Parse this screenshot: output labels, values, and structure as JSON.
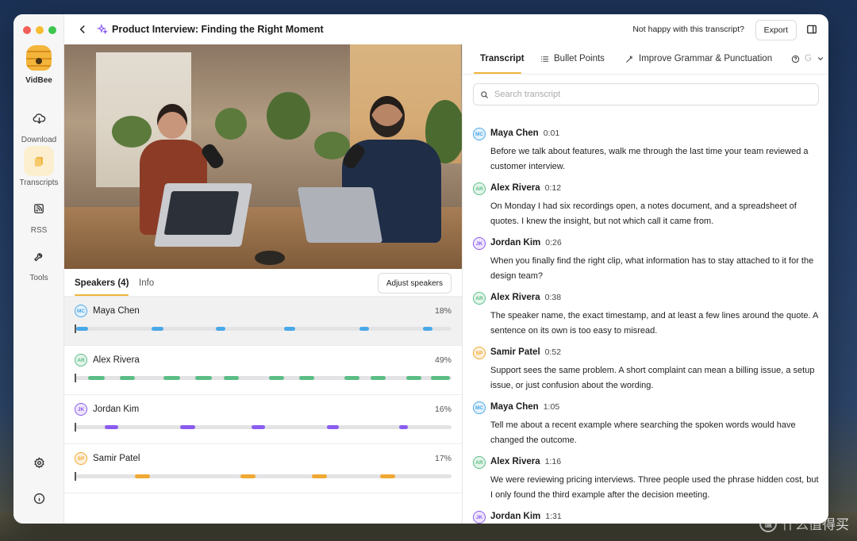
{
  "window": {
    "title": "Product Interview: Finding the Right Moment",
    "not_happy": "Not happy with this transcript?",
    "export_label": "Export"
  },
  "sidebar": {
    "app_name": "VidBee",
    "items": [
      {
        "label": "Download",
        "icon": "download-icon"
      },
      {
        "label": "Transcripts",
        "icon": "transcripts-icon",
        "active": true
      },
      {
        "label": "RSS",
        "icon": "rss-icon"
      },
      {
        "label": "Tools",
        "icon": "tools-icon"
      }
    ]
  },
  "speakers_panel": {
    "tab_speakers": "Speakers (4)",
    "tab_info": "Info",
    "adjust_label": "Adjust speakers",
    "speakers": [
      {
        "initials": "MC",
        "name": "Maya Chen",
        "percent": "18%",
        "color": "#4aa8e8",
        "bg": "#e3f1fb",
        "segments": [
          [
            0.5,
            3.5
          ],
          [
            20.5,
            23.5
          ],
          [
            37.5,
            40
          ],
          [
            55.5,
            58.5
          ],
          [
            75.5,
            78
          ],
          [
            92.5,
            95
          ]
        ]
      },
      {
        "initials": "AR",
        "name": "Alex Rivera",
        "percent": "49%",
        "color": "#5bbd85",
        "bg": "#e4f5ea",
        "segments": [
          [
            3.5,
            8
          ],
          [
            12,
            16
          ],
          [
            23.5,
            28
          ],
          [
            32,
            36.5
          ],
          [
            39.5,
            43.5
          ],
          [
            51.5,
            55.5
          ],
          [
            59.5,
            63.5
          ],
          [
            71.5,
            75.5
          ],
          [
            78.5,
            82.5
          ],
          [
            88,
            92
          ],
          [
            94.5,
            99.5
          ]
        ]
      },
      {
        "initials": "JK",
        "name": "Jordan Kim",
        "percent": "16%",
        "color": "#8a5cf0",
        "bg": "#eee6fd",
        "segments": [
          [
            8,
            11.5
          ],
          [
            28,
            32
          ],
          [
            47,
            50.5
          ],
          [
            67,
            70
          ],
          [
            86,
            88.5
          ]
        ]
      },
      {
        "initials": "SP",
        "name": "Samir Patel",
        "percent": "17%",
        "color": "#f0a933",
        "bg": "#fdf0db",
        "segments": [
          [
            16,
            20
          ],
          [
            44,
            48
          ],
          [
            63,
            67
          ],
          [
            81,
            85
          ]
        ]
      }
    ]
  },
  "transcript_panel": {
    "tabs": [
      {
        "label": "Transcript",
        "active": true
      },
      {
        "label": "Bullet Points",
        "icon": "list-icon"
      },
      {
        "label": "Improve Grammar & Punctuation",
        "icon": "sparkle-icon"
      },
      {
        "label": "G",
        "icon": "help-icon"
      }
    ],
    "search_placeholder": "Search transcript",
    "entries": [
      {
        "initials": "MC",
        "name": "Maya Chen",
        "time": "0:01",
        "color": "#4aa8e8",
        "bg": "#e3f1fb",
        "text": "Before we talk about features, walk me through the last time your team reviewed a customer interview."
      },
      {
        "initials": "AR",
        "name": "Alex Rivera",
        "time": "0:12",
        "color": "#5bbd85",
        "bg": "#e4f5ea",
        "text": "On Monday I had six recordings open, a notes document, and a spreadsheet of quotes. I knew the insight, but not which call it came from."
      },
      {
        "initials": "JK",
        "name": "Jordan Kim",
        "time": "0:26",
        "color": "#8a5cf0",
        "bg": "#eee6fd",
        "text": "When you finally find the right clip, what information has to stay attached to it for the design team?"
      },
      {
        "initials": "AR",
        "name": "Alex Rivera",
        "time": "0:38",
        "color": "#5bbd85",
        "bg": "#e4f5ea",
        "text": "The speaker name, the exact timestamp, and at least a few lines around the quote. A sentence on its own is too easy to misread."
      },
      {
        "initials": "SP",
        "name": "Samir Patel",
        "time": "0:52",
        "color": "#f0a933",
        "bg": "#fdf0db",
        "text": "Support sees the same problem. A short complaint can mean a billing issue, a setup issue, or just confusion about the wording."
      },
      {
        "initials": "MC",
        "name": "Maya Chen",
        "time": "1:05",
        "color": "#4aa8e8",
        "bg": "#e3f1fb",
        "text": "Tell me about a recent example where searching the spoken words would have changed the outcome."
      },
      {
        "initials": "AR",
        "name": "Alex Rivera",
        "time": "1:16",
        "color": "#5bbd85",
        "bg": "#e4f5ea",
        "text": "We were reviewing pricing interviews. Three people used the phrase hidden cost, but I only found the third example after the decision meeting."
      },
      {
        "initials": "JK",
        "name": "Jordan Kim",
        "time": "1:31",
        "color": "#8a5cf0",
        "bg": "#eee6fd",
        "text": ""
      }
    ]
  },
  "watermark": {
    "logo": "值",
    "text": "什么值得买"
  }
}
